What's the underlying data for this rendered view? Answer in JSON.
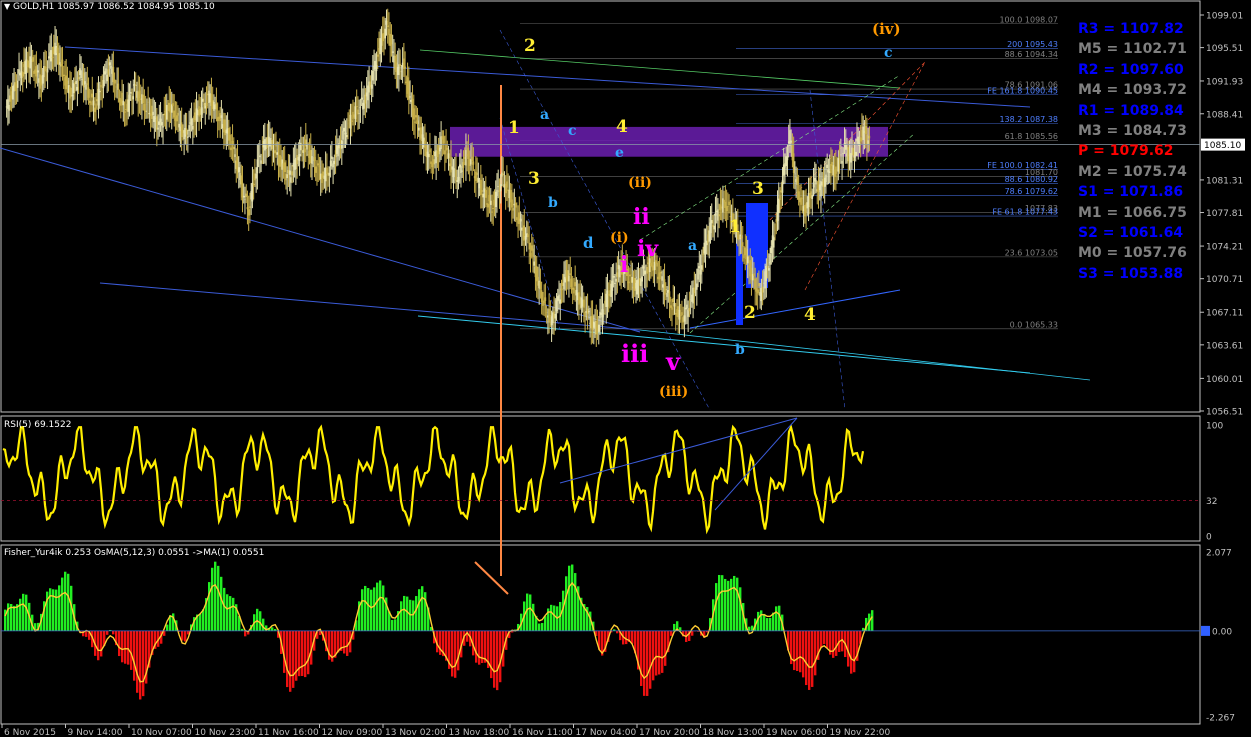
{
  "header": {
    "symbol": "GOLD,H1",
    "ohlc": "1085.97 1086.52 1084.95 1085.10",
    "rsi_label": "RSI(5) 69.1522",
    "fisher_label": "Fisher_Yur4ik 0.253 OsMA(5,12,3) 0.0551 ->MA(1) 0.0551"
  },
  "price_axis": {
    "labels": [
      "1099.01",
      "1095.51",
      "1091.93",
      "1088.41",
      "1085.10",
      "1081.31",
      "1077.81",
      "1074.21",
      "1070.71",
      "1067.11",
      "1063.61",
      "1060.01",
      "1056.51"
    ],
    "current": "1085.10"
  },
  "rsi_axis": {
    "labels": [
      "100",
      "32",
      "0"
    ]
  },
  "fisher_axis": {
    "labels": [
      "2.077",
      "0.00",
      "-2.267"
    ]
  },
  "time_axis": {
    "labels": [
      "6 Nov 2015",
      "9 Nov 14:00",
      "10 Nov 07:00",
      "10 Nov 23:00",
      "11 Nov 16:00",
      "12 Nov 09:00",
      "13 Nov 02:00",
      "13 Nov 18:00",
      "16 Nov 11:00",
      "17 Nov 04:00",
      "17 Nov 20:00",
      "18 Nov 13:00",
      "19 Nov 06:00",
      "19 Nov 22:00"
    ]
  },
  "pivots": [
    {
      "text": "R3 = 1107.82",
      "color": "#0000ff"
    },
    {
      "text": "M5 = 1102.71",
      "color": "#808080"
    },
    {
      "text": "R2 = 1097.60",
      "color": "#0000ff"
    },
    {
      "text": "M4 = 1093.72",
      "color": "#808080"
    },
    {
      "text": "R1 = 1089.84",
      "color": "#0000ff"
    },
    {
      "text": "M3 = 1084.73",
      "color": "#808080"
    },
    {
      "text": "P = 1079.62",
      "color": "#ff0000"
    },
    {
      "text": "M2 = 1075.74",
      "color": "#808080"
    },
    {
      "text": "S1 = 1071.86",
      "color": "#0000ff"
    },
    {
      "text": "M1 = 1066.75",
      "color": "#808080"
    },
    {
      "text": "S2 = 1061.64",
      "color": "#0000ff"
    },
    {
      "text": "M0 = 1057.76",
      "color": "#808080"
    },
    {
      "text": "S3 = 1053.88",
      "color": "#0000ff"
    }
  ],
  "fib_levels": [
    {
      "text": "100.0 1098.07",
      "price": 1098.07,
      "color": "#808080"
    },
    {
      "text": "200 1095.43",
      "price": 1095.43,
      "color": "#4f7fff"
    },
    {
      "text": "88.6 1094.34",
      "price": 1094.34,
      "color": "#808080"
    },
    {
      "text": "78.6 1091.06",
      "price": 1091.06,
      "color": "#808080"
    },
    {
      "text": "FE 161.8 1090.45",
      "price": 1090.45,
      "color": "#4f7fff"
    },
    {
      "text": "138.2 1087.38",
      "price": 1087.38,
      "color": "#4f7fff"
    },
    {
      "text": "61.8 1085.56",
      "price": 1085.56,
      "color": "#808080"
    },
    {
      "text": "FE 100.0 1082.41",
      "price": 1082.41,
      "color": "#4f7fff"
    },
    {
      "text": "1081.70",
      "price": 1081.7,
      "color": "#808080"
    },
    {
      "text": "88.6 1080.92",
      "price": 1080.92,
      "color": "#4f7fff"
    },
    {
      "text": "78.6 1079.62",
      "price": 1079.62,
      "color": "#4f7fff"
    },
    {
      "text": "1077.83",
      "price": 1077.83,
      "color": "#808080"
    },
    {
      "text": "FE 61.8 1077.43",
      "price": 1077.43,
      "color": "#4f7fff"
    },
    {
      "text": "23.6 1073.05",
      "price": 1073.05,
      "color": "#808080"
    },
    {
      "text": "0.0 1065.33",
      "price": 1065.33,
      "color": "#808080"
    }
  ],
  "wave_labels": [
    {
      "text": "(iv)",
      "color": "#ff9900"
    },
    {
      "text": "c",
      "color": "#33aaff"
    },
    {
      "text": "2",
      "color": "#ffee33"
    },
    {
      "text": "1",
      "color": "#ffee33"
    },
    {
      "text": "a",
      "color": "#33aaff"
    },
    {
      "text": "c",
      "color": "#33aaff"
    },
    {
      "text": "4",
      "color": "#ffee33"
    },
    {
      "text": "e",
      "color": "#33aaff"
    },
    {
      "text": "3",
      "color": "#ffee33"
    },
    {
      "text": "(ii)",
      "color": "#ff9900"
    },
    {
      "text": "b",
      "color": "#33aaff"
    },
    {
      "text": "ii",
      "color": "#ff00ff"
    },
    {
      "text": "3",
      "color": "#ffee33"
    },
    {
      "text": "d",
      "color": "#33aaff"
    },
    {
      "text": "(i)",
      "color": "#ff9900"
    },
    {
      "text": "iv",
      "color": "#ff00ff"
    },
    {
      "text": "i",
      "color": "#ff00ff"
    },
    {
      "text": "a",
      "color": "#33aaff"
    },
    {
      "text": "1",
      "color": "#ffee33"
    },
    {
      "text": "2",
      "color": "#ffee33"
    },
    {
      "text": "4",
      "color": "#ffee33"
    },
    {
      "text": "iii",
      "color": "#ff00ff"
    },
    {
      "text": "b",
      "color": "#33aaff"
    },
    {
      "text": "v",
      "color": "#ff00ff"
    },
    {
      "text": "(iii)",
      "color": "#ff9900"
    }
  ],
  "chart_data": {
    "type": "line",
    "price_range": [
      1056.51,
      1099.01
    ],
    "rsi": {
      "period": 5,
      "value": 69.1522,
      "range": [
        0,
        100
      ],
      "level": 32
    },
    "fisher": {
      "value": 0.253,
      "osma": 0.0551,
      "ma": 0.0551,
      "range": [
        -2.267,
        2.077
      ]
    },
    "last_close": 1085.1,
    "close_path": [
      1088.5,
      1090.2,
      1091.5,
      1092.8,
      1093.4,
      1094.1,
      1093.0,
      1091.8,
      1093.2,
      1094.5,
      1095.4,
      1094.0,
      1092.1,
      1090.5,
      1091.3,
      1092.6,
      1091.7,
      1090.1,
      1089.2,
      1090.8,
      1092.3,
      1093.5,
      1092.0,
      1090.4,
      1088.7,
      1089.9,
      1091.0,
      1090.2,
      1089.4,
      1088.9,
      1087.8,
      1086.9,
      1088.1,
      1089.3,
      1088.6,
      1087.2,
      1086.0,
      1086.8,
      1087.9,
      1088.8,
      1089.5,
      1090.3,
      1089.1,
      1088.0,
      1087.1,
      1085.9,
      1084.2,
      1082.0,
      1079.5,
      1078.1,
      1081.3,
      1083.4,
      1084.8,
      1085.6,
      1084.9,
      1083.7,
      1082.5,
      1081.4,
      1082.6,
      1084.0,
      1085.2,
      1084.3,
      1083.1,
      1082.2,
      1081.5,
      1082.4,
      1083.6,
      1084.7,
      1085.9,
      1087.1,
      1088.3,
      1089.0,
      1089.6,
      1090.8,
      1092.5,
      1094.8,
      1096.9,
      1098.0,
      1094.6,
      1092.8,
      1093.9,
      1091.2,
      1088.7,
      1087.0,
      1085.5,
      1084.1,
      1083.2,
      1084.4,
      1085.6,
      1083.9,
      1082.3,
      1081.6,
      1083.0,
      1084.1,
      1082.8,
      1081.2,
      1080.1,
      1079.3,
      1078.2,
      1079.9,
      1081.4,
      1080.3,
      1078.9,
      1077.6,
      1076.1,
      1074.9,
      1073.3,
      1070.8,
      1068.9,
      1067.2,
      1066.1,
      1067.8,
      1069.6,
      1071.4,
      1070.2,
      1069.1,
      1068.0,
      1067.1,
      1066.0,
      1065.3,
      1066.9,
      1068.4,
      1069.8,
      1071.1,
      1072.0,
      1071.3,
      1070.5,
      1069.7,
      1070.9,
      1071.8,
      1072.4,
      1071.9,
      1070.6,
      1069.4,
      1068.2,
      1067.4,
      1066.5,
      1066.9,
      1068.2,
      1070.1,
      1072.3,
      1074.4,
      1076.1,
      1077.2,
      1078.3,
      1079.0,
      1077.6,
      1076.2,
      1074.8,
      1073.2,
      1071.6,
      1070.1,
      1069.0,
      1070.8,
      1073.1,
      1076.4,
      1079.8,
      1083.1,
      1086.0,
      1081.5,
      1079.2,
      1078.1,
      1079.6,
      1081.0,
      1080.2,
      1081.6,
      1082.9,
      1082.1,
      1083.4,
      1084.6,
      1083.8,
      1084.5,
      1085.9,
      1086.5,
      1085.1
    ]
  }
}
